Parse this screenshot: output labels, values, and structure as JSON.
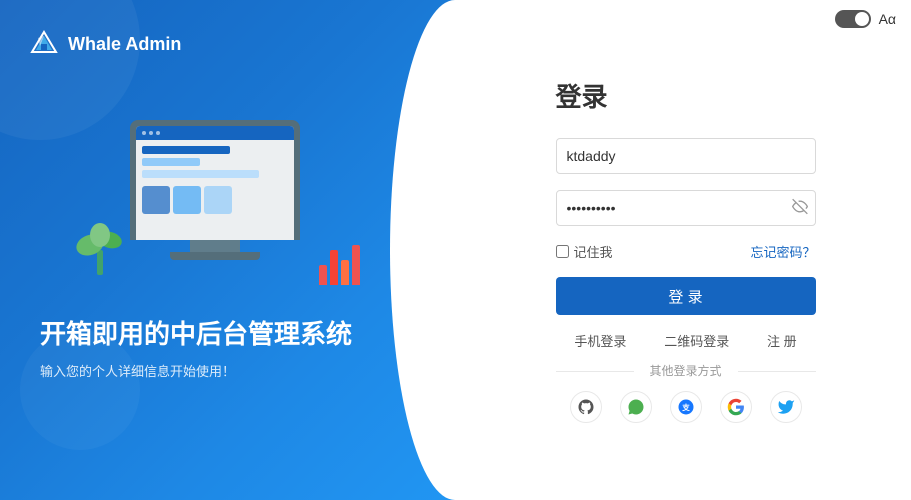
{
  "app": {
    "name": "Whale Admin"
  },
  "left": {
    "main_title": "开箱即用的中后台管理系统",
    "sub_title": "输入您的个人详细信息开始使用！"
  },
  "form": {
    "title": "登录",
    "username_placeholder": "ktdaddy",
    "password_placeholder": "••••••••••",
    "remember_label": "记住我",
    "forgot_label": "忘记密码？",
    "login_button": "登 录",
    "phone_login": "手机登录",
    "qrcode_login": "二维码登录",
    "register": "注 册",
    "other_login_label": "其他登录方式"
  },
  "controls": {
    "toggle_label": "dark mode toggle",
    "lang_label": "Aα"
  }
}
